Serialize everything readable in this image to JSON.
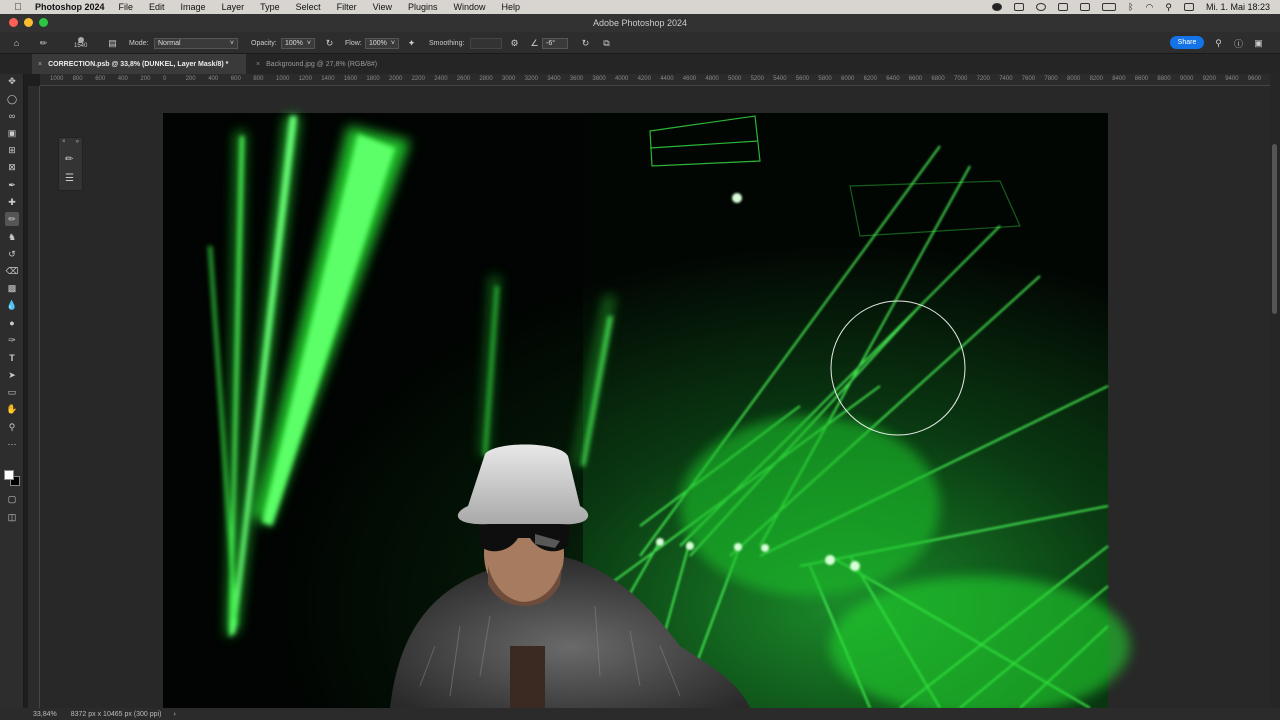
{
  "menubar": {
    "app_name": "Photoshop 2024",
    "items": [
      "File",
      "Edit",
      "Image",
      "Layer",
      "Type",
      "Select",
      "Filter",
      "View",
      "Plugins",
      "Window",
      "Help"
    ],
    "clock": "Mi. 1. Mai  18:23"
  },
  "window": {
    "title": "Adobe Photoshop 2024"
  },
  "options": {
    "brush_size": "1540",
    "mode_label": "Mode:",
    "mode_value": "Normal",
    "opacity_label": "Opacity:",
    "opacity_value": "100%",
    "flow_label": "Flow:",
    "flow_value": "100%",
    "smoothing_label": "Smoothing:",
    "angle_value": "-6°",
    "share_label": "Share"
  },
  "tabs": [
    {
      "label": "CORRECTION.psb @ 33,8% (DUNKEL, Layer Mask/8) *",
      "active": true
    },
    {
      "label": "Background.jpg @ 27,8% (RGB/8#)",
      "active": false
    }
  ],
  "ruler_ticks": [
    "1000",
    "800",
    "600",
    "400",
    "200",
    "0",
    "200",
    "400",
    "600",
    "800",
    "1000",
    "1200",
    "1400",
    "1600",
    "1800",
    "2000",
    "2200",
    "2400",
    "2600",
    "2800",
    "3000",
    "3200",
    "3400",
    "3600",
    "3800",
    "4000",
    "4200",
    "4400",
    "4600",
    "4800",
    "5000",
    "5200",
    "5400",
    "5600",
    "5800",
    "6000",
    "6200",
    "6400",
    "6600",
    "6800",
    "7000",
    "7200",
    "7400",
    "7600",
    "7800",
    "8000",
    "8200",
    "8400",
    "8600",
    "8800",
    "9000",
    "9200",
    "9400",
    "9600"
  ],
  "status": {
    "zoom": "33,84%",
    "doc_size": "8372 px x 10465 px (300 ppi)"
  },
  "colors": {
    "accent": "#1473e6",
    "laser": "#2cff3a"
  }
}
